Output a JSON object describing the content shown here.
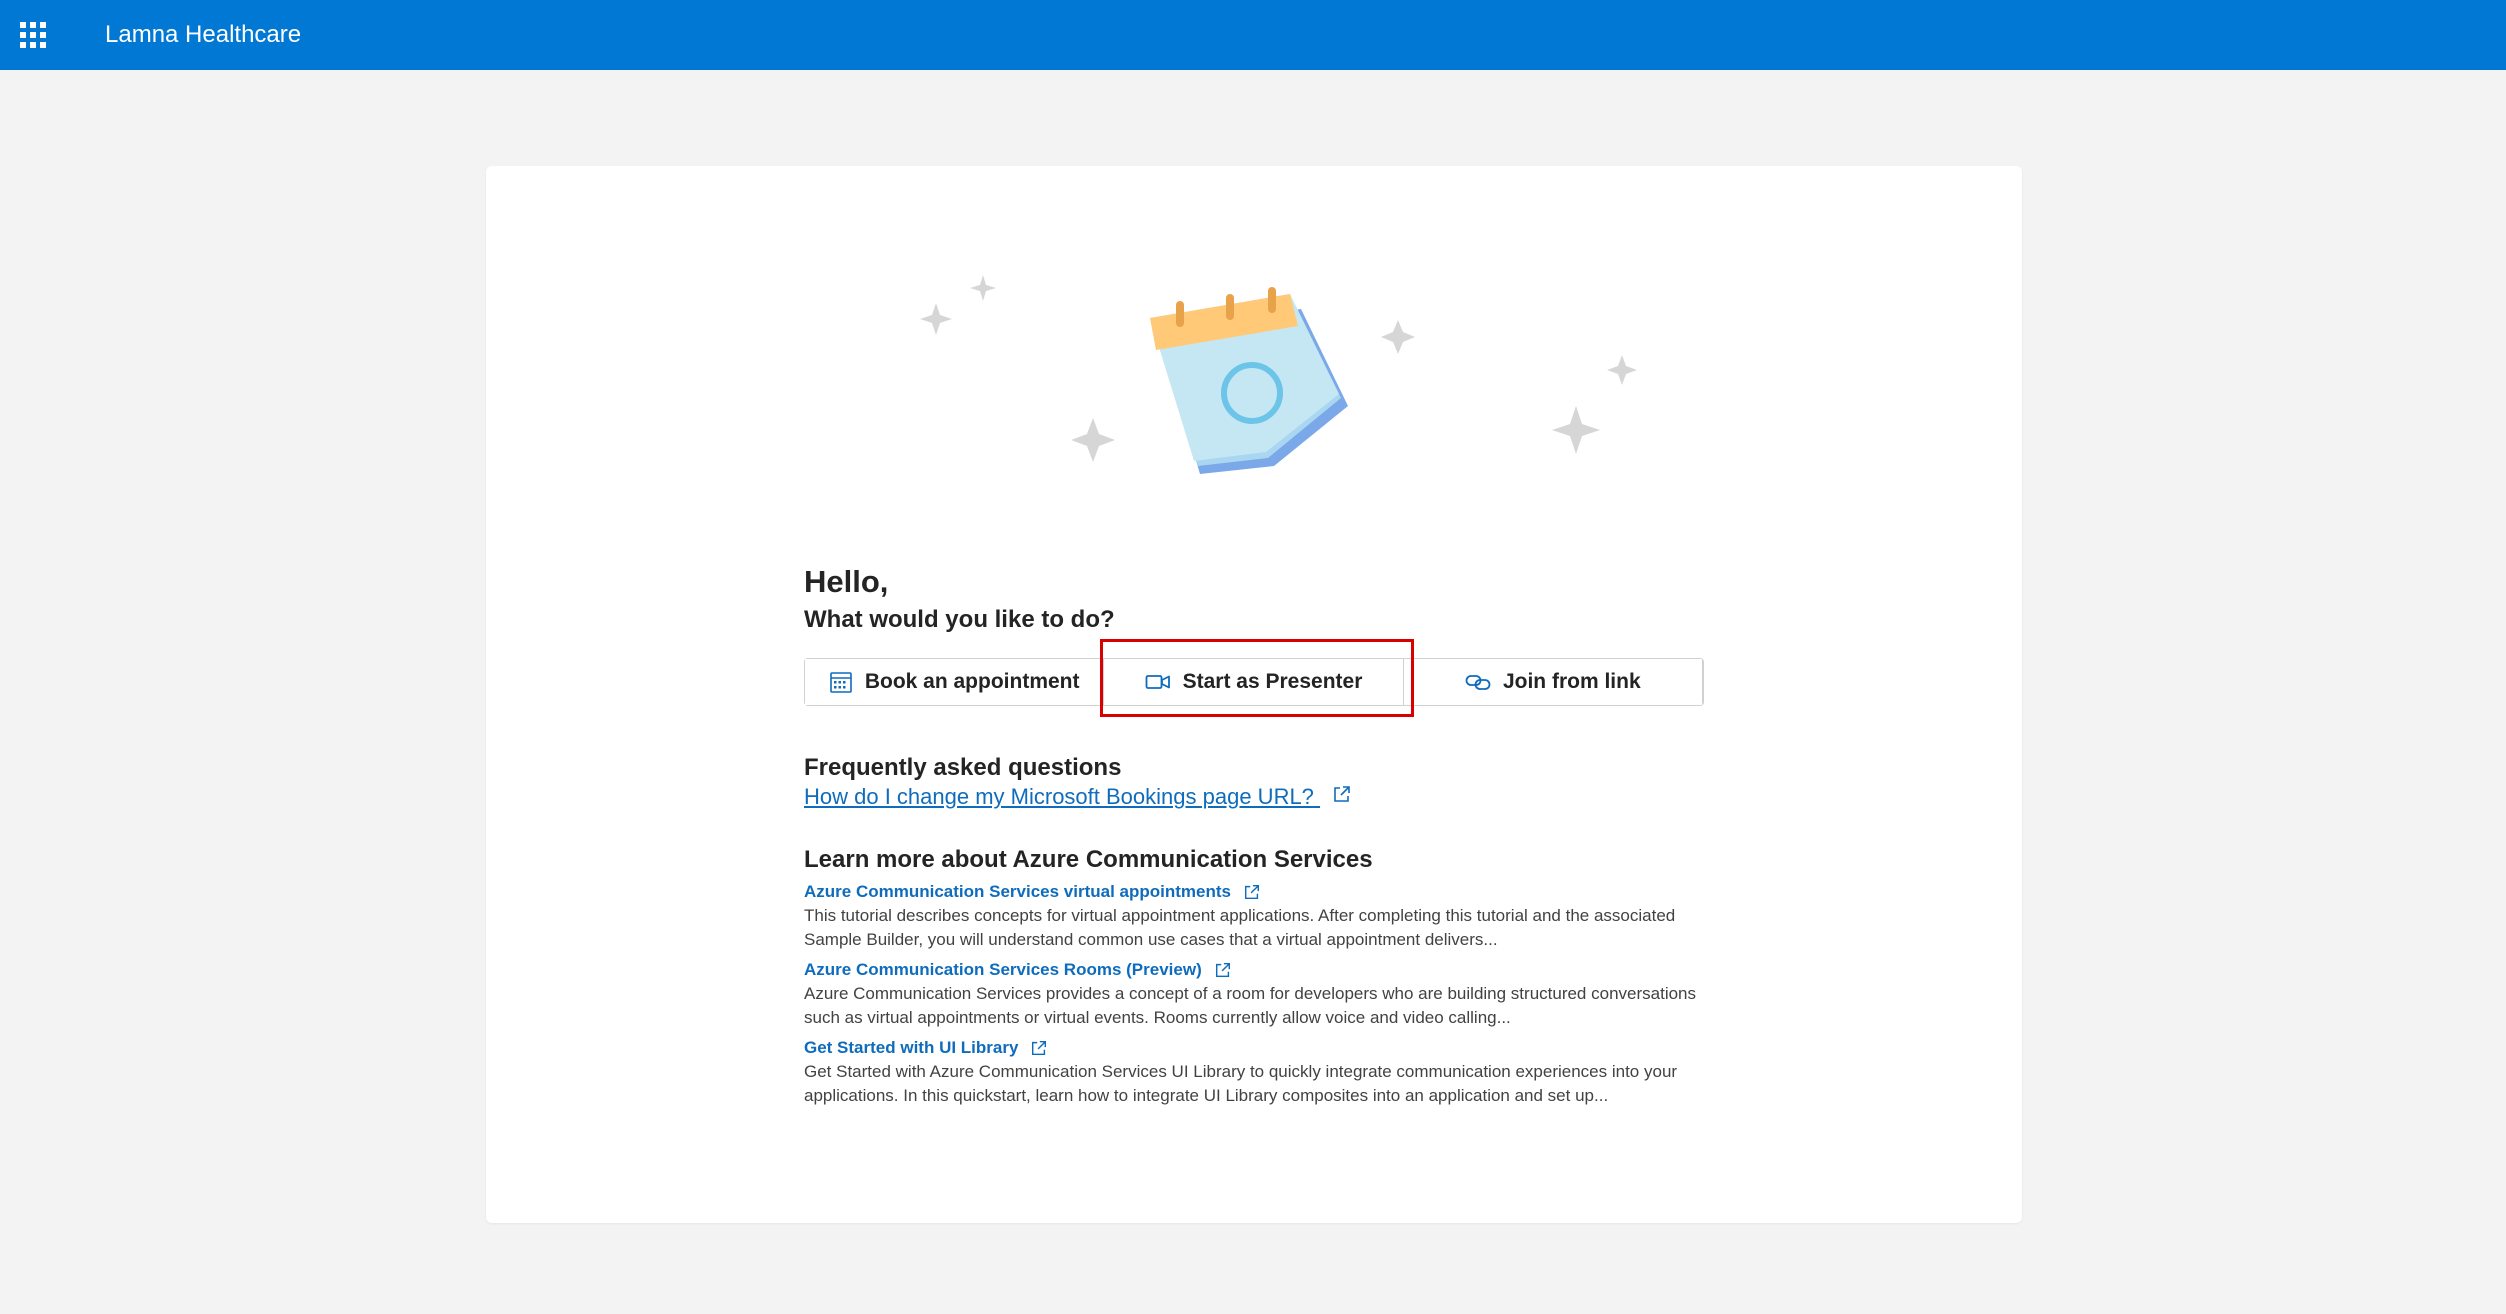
{
  "header": {
    "title": "Lamna Healthcare"
  },
  "greeting": {
    "hello": "Hello,",
    "question": "What would you like to do?"
  },
  "actions": [
    {
      "label": "Book an appointment",
      "icon": "calendar-icon"
    },
    {
      "label": "Start as Presenter",
      "icon": "video-camera-icon"
    },
    {
      "label": "Join from link",
      "icon": "link-icon"
    }
  ],
  "faq": {
    "title": "Frequently asked questions",
    "link": "How do I change my Microsoft Bookings page URL?"
  },
  "learn": {
    "title": "Learn more about Azure Communication Services",
    "items": [
      {
        "link": "Azure Communication Services virtual appointments",
        "desc": "This tutorial describes concepts for virtual appointment applications. After completing this tutorial and the associated Sample Builder, you will understand common use cases that a virtual appointment delivers..."
      },
      {
        "link": "Azure Communication Services Rooms (Preview)",
        "desc": "Azure Communication Services provides a concept of a room for developers who are building structured conversations such as virtual appointments or virtual events. Rooms currently allow voice and video calling..."
      },
      {
        "link": "Get Started with UI Library",
        "desc": "Get Started with Azure Communication Services UI Library to quickly integrate communication experiences into your applications. In this quickstart, learn how to integrate UI Library composites into an application and set up..."
      }
    ]
  },
  "colors": {
    "brand": "#0078d4",
    "link": "#0f6cbd",
    "highlight": "#d90000"
  }
}
